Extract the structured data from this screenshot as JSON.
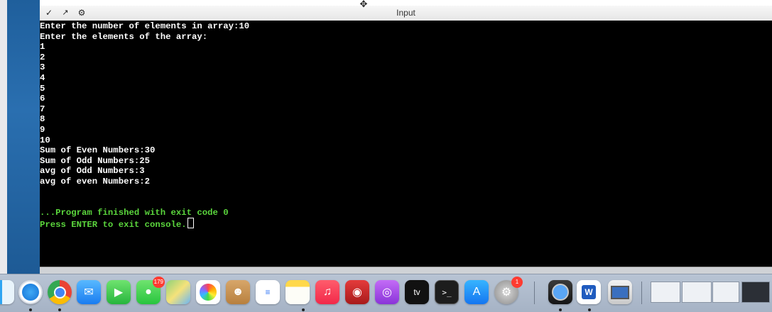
{
  "window": {
    "title": "Input",
    "icons": [
      "chevron-down-icon",
      "expand-icon",
      "settings-icon",
      "move-cursor-icon"
    ]
  },
  "console": {
    "lines": [
      "Enter the number of elements in array:10",
      "Enter the elements of the array:",
      "1",
      "2",
      "3",
      "4",
      "5",
      "6",
      "7",
      "8",
      "9",
      "10",
      "Sum of Even Numbers:30",
      "Sum of Odd Numbers:25",
      "avg of Odd Numbers:3",
      "avg of even Numbers:2",
      "",
      "",
      "...Program finished with exit code 0",
      "Press ENTER to exit console."
    ],
    "colors": {
      "text": "#ffffff",
      "status": "#5bd63d",
      "background": "#000000"
    }
  },
  "dock": {
    "apps": [
      {
        "name": "finder",
        "icon": "finder-icon"
      },
      {
        "name": "safari",
        "icon": "safari-icon"
      },
      {
        "name": "chrome",
        "icon": "chrome-icon"
      },
      {
        "name": "mail",
        "icon": "mail-icon"
      },
      {
        "name": "facetime",
        "icon": "facetime-icon"
      },
      {
        "name": "messages",
        "icon": "messages-icon",
        "badge": "179"
      },
      {
        "name": "maps",
        "icon": "maps-icon"
      },
      {
        "name": "photos",
        "icon": "photos-icon"
      },
      {
        "name": "contacts",
        "icon": "contacts-icon"
      },
      {
        "name": "reminders",
        "icon": "reminders-icon"
      },
      {
        "name": "notes",
        "icon": "notes-icon"
      },
      {
        "name": "music",
        "icon": "music-icon"
      },
      {
        "name": "photo-booth",
        "icon": "photo-booth-icon"
      },
      {
        "name": "podcasts",
        "icon": "podcasts-icon"
      },
      {
        "name": "apple-tv",
        "icon": "apple-tv-icon",
        "label": "tv"
      },
      {
        "name": "terminal",
        "icon": "terminal-icon"
      },
      {
        "name": "app-store",
        "icon": "app-store-icon"
      },
      {
        "name": "system-preferences",
        "icon": "system-preferences-icon",
        "badge": "1"
      },
      {
        "name": "quicktime",
        "icon": "quicktime-icon"
      },
      {
        "name": "word",
        "icon": "word-icon",
        "label": "W"
      },
      {
        "name": "screen-sharing",
        "icon": "screen-sharing-icon"
      },
      {
        "name": "window-thumbnail-1",
        "icon": "window-thumbnail-icon"
      },
      {
        "name": "window-thumbnail-2",
        "icon": "window-thumbnail-icon"
      },
      {
        "name": "window-thumbnail-3",
        "icon": "window-thumbnail-icon"
      },
      {
        "name": "window-thumbnail-4",
        "icon": "window-thumbnail-icon"
      }
    ]
  }
}
